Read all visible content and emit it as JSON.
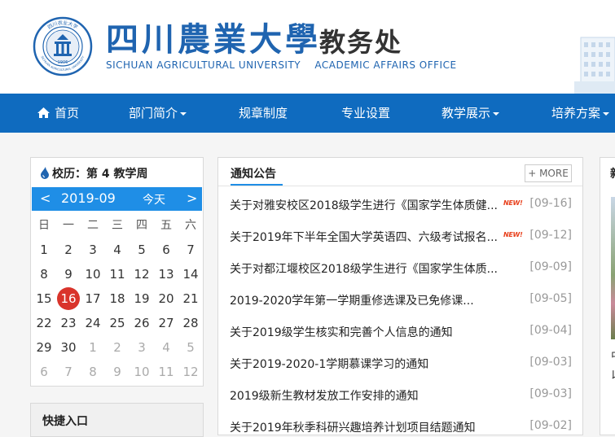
{
  "header": {
    "school_name_cn": "四川農業大學",
    "office_name_cn": "教务处",
    "school_name_en": "SICHUAN AGRICULTURAL UNIVERSITY    ACADEMIC AFFAIRS OFFICE",
    "seal_text": "四川农业大学",
    "seal_year": "1906",
    "seal_en": "SICHUAN AGRICULTURAL UNIVERSITY",
    "brand_color": "#1f64b0"
  },
  "nav": {
    "items": [
      {
        "label": "首页",
        "icon": "home-icon"
      },
      {
        "label": "部门简介",
        "dropdown": true
      },
      {
        "label": "规章制度"
      },
      {
        "label": "专业设置"
      },
      {
        "label": "教学展示",
        "dropdown": true
      },
      {
        "label": "培养方案",
        "dropdown": true
      }
    ],
    "bg_color": "#0f6bbf"
  },
  "calendar": {
    "title": "校历：第 4 教学周",
    "prev": "<",
    "month": "2019-09",
    "today_label": "今天",
    "next": ">",
    "weekdays": [
      "日",
      "一",
      "二",
      "三",
      "四",
      "五",
      "六"
    ],
    "weeks": [
      [
        "1",
        "2",
        "3",
        "4",
        "5",
        "6",
        "7"
      ],
      [
        "8",
        "9",
        "10",
        "11",
        "12",
        "13",
        "14"
      ],
      [
        "15",
        "16",
        "17",
        "18",
        "19",
        "20",
        "21"
      ],
      [
        "22",
        "23",
        "24",
        "25",
        "26",
        "27",
        "28"
      ],
      [
        "29",
        "30",
        "1",
        "2",
        "3",
        "4",
        "5"
      ],
      [
        "6",
        "7",
        "8",
        "9",
        "10",
        "11",
        "12"
      ]
    ],
    "today": "16",
    "accent": "#1f8ee6",
    "today_color": "#d9342b"
  },
  "quick": {
    "title": "快捷入口"
  },
  "notices": {
    "title": "通知公告",
    "more": "+ MORE",
    "new_badge": "NEW!",
    "items": [
      {
        "text": "关于对雅安校区2018级学生进行《国家学生体质健...",
        "date": "[09-16]",
        "new": true
      },
      {
        "text": "关于2019年下半年全国大学英语四、六级考试报名...",
        "date": "[09-12]",
        "new": true
      },
      {
        "text": "关于对都江堰校区2018级学生进行《国家学生体质...",
        "date": "[09-09]",
        "new": false
      },
      {
        "text": "2019-2020学年第一学期重修选课及已免修课...",
        "date": "[09-05]",
        "new": false
      },
      {
        "text": "关于2019级学生核实和完善个人信息的通知",
        "date": "[09-04]",
        "new": false
      },
      {
        "text": "关于2019-2020-1学期慕课学习的通知",
        "date": "[09-03]",
        "new": false
      },
      {
        "text": "2019级新生教材发放工作安排的通知",
        "date": "[09-03]",
        "new": false
      },
      {
        "text": "关于2019年秋季科研兴趣培养计划项目结题通知",
        "date": "[09-02]",
        "new": false
      }
    ]
  },
  "right_panel": {
    "title": "新",
    "chars": [
      "中",
      "以"
    ]
  }
}
